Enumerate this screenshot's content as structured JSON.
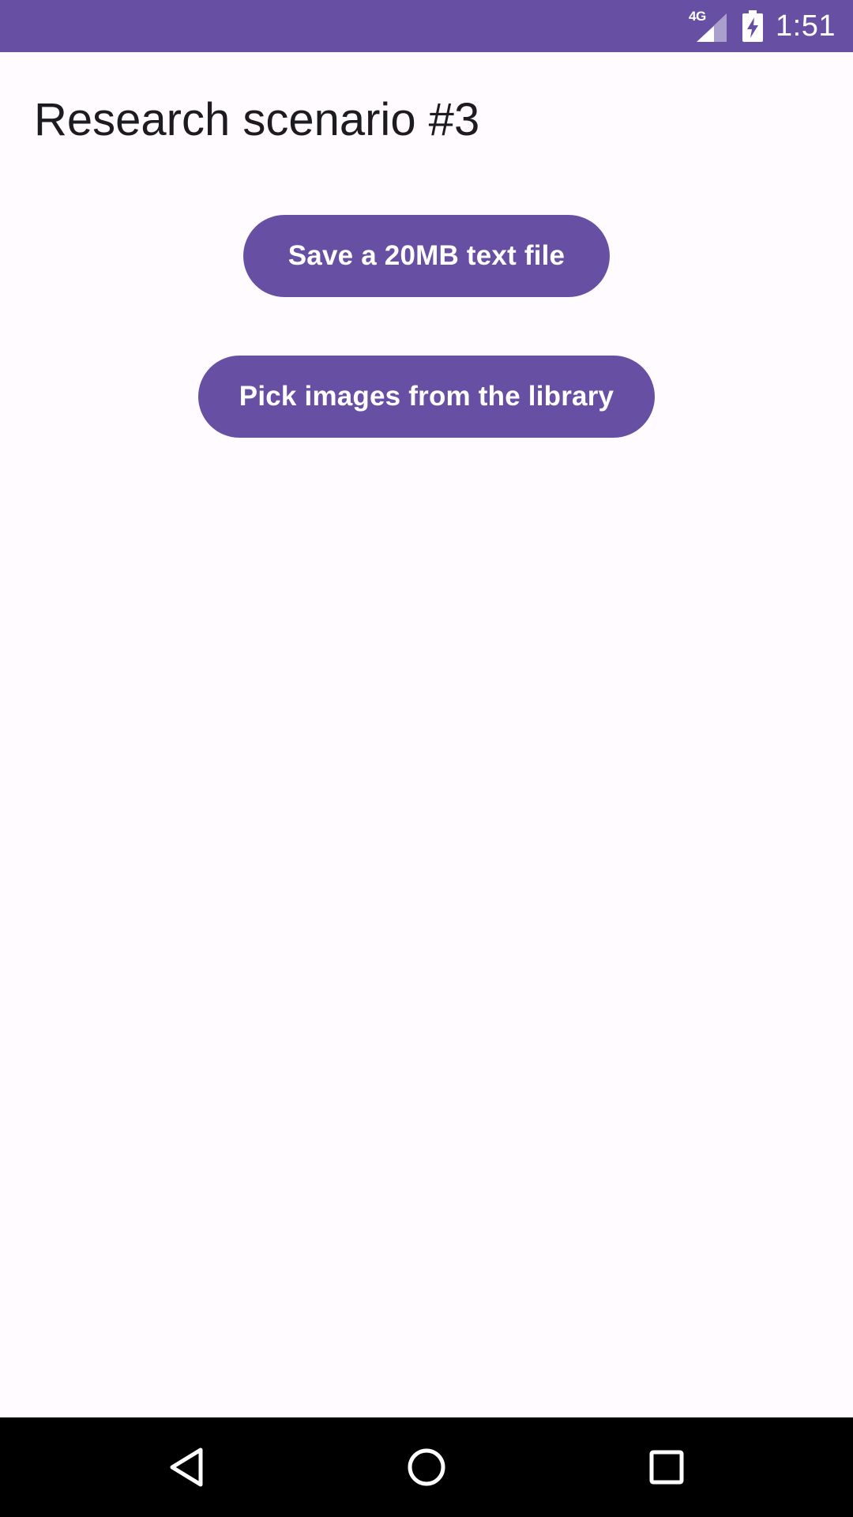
{
  "status_bar": {
    "network_type": "4G",
    "time": "1:51",
    "background_color": "#6750a4",
    "icons": [
      "cellular-signal-icon",
      "battery-charging-icon"
    ]
  },
  "page": {
    "title": "Research scenario #3",
    "background_color": "#fffbfe"
  },
  "actions": {
    "save_label": "Save a 20MB text file",
    "pick_label": "Pick images from the library",
    "button_color": "#6750a4"
  },
  "nav_bar": {
    "icons": [
      "back-icon",
      "home-icon",
      "recents-icon"
    ]
  }
}
